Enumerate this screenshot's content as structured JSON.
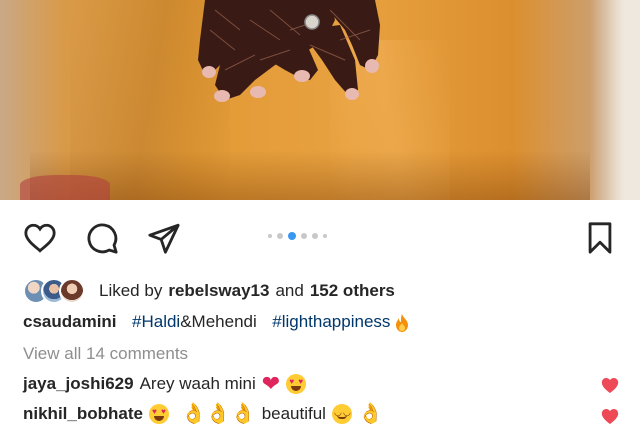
{
  "post": {
    "image_alt": "Hands with mehendi on orange outfit",
    "carousel": {
      "count": 5,
      "active": 2
    }
  },
  "actions": {
    "like_icon": "heart-outline-icon",
    "comment_icon": "comment-bubble-icon",
    "share_icon": "paper-plane-icon",
    "save_icon": "bookmark-icon"
  },
  "likes": {
    "prefix": "Liked by",
    "user": "rebelsway13",
    "joiner": "and",
    "others": "152 others"
  },
  "caption": {
    "username": "csaudamini",
    "hashtag1": "#Haldi",
    "text": "&Mehendi",
    "hashtag2": "#lighthappiness"
  },
  "view_all": "View all 14 comments",
  "comments": [
    {
      "username": "jaya_joshi629",
      "text": "Arey waah mini"
    },
    {
      "username": "nikhil_bobhate",
      "text": "beautiful"
    }
  ],
  "colors": {
    "hashtag": "#00376b",
    "muted": "#8e8e8e",
    "like_red": "#ed4956",
    "dot_active": "#3897f0"
  }
}
